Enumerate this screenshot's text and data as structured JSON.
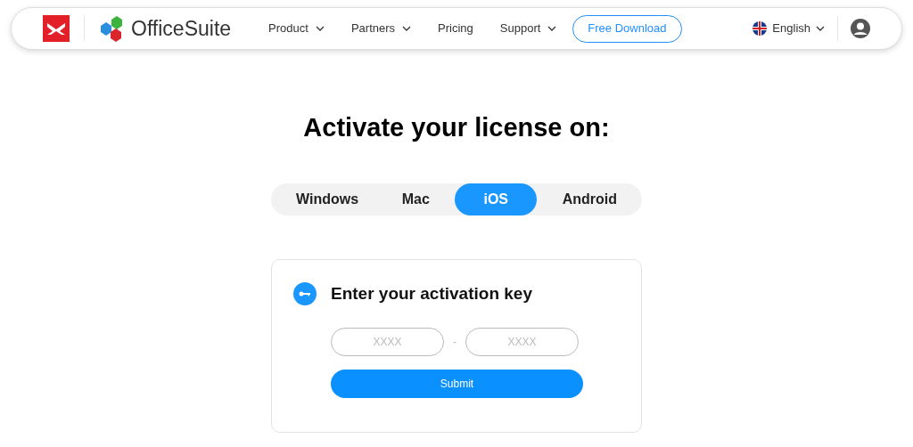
{
  "header": {
    "brand": "OfficeSuite",
    "nav": [
      {
        "label": "Product",
        "has_menu": true
      },
      {
        "label": "Partners",
        "has_menu": true
      },
      {
        "label": "Pricing",
        "has_menu": false
      },
      {
        "label": "Support",
        "has_menu": true
      }
    ],
    "cta": "Free Download",
    "language": "English"
  },
  "title": "Activate your license on:",
  "platforms": [
    {
      "label": "Windows",
      "selected": false
    },
    {
      "label": "Mac",
      "selected": false
    },
    {
      "label": "iOS",
      "selected": true
    },
    {
      "label": "Android",
      "selected": false
    }
  ],
  "card": {
    "heading": "Enter your activation key",
    "fields": [
      {
        "placeholder": "XXXX"
      },
      {
        "placeholder": "XXXX"
      }
    ],
    "separator": "-",
    "submit": "Submit"
  }
}
